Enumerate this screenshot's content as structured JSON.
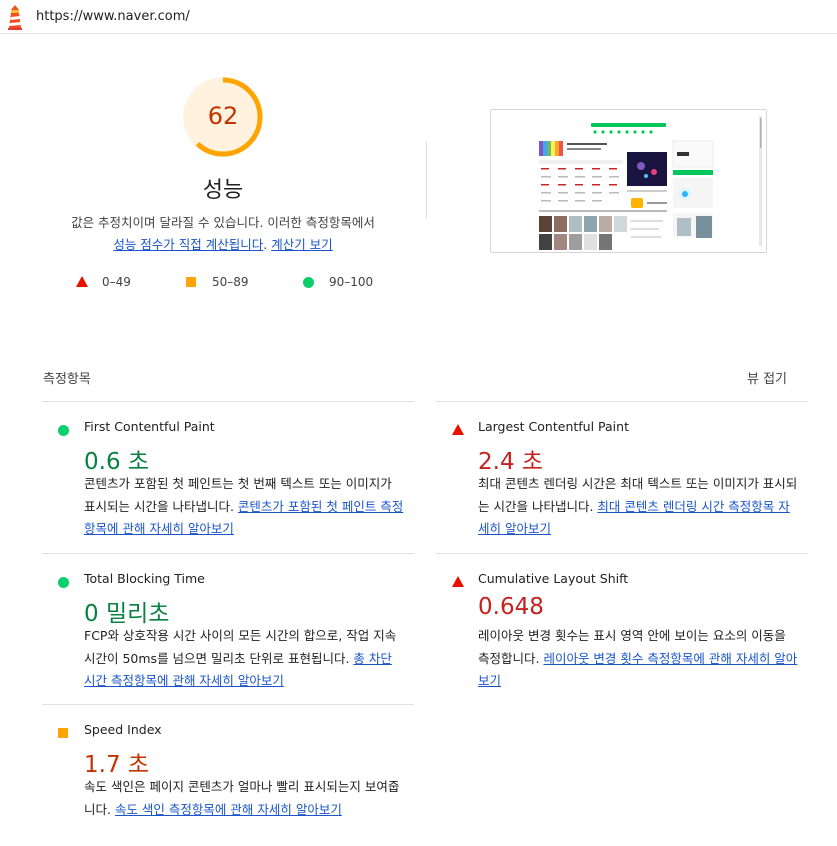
{
  "browser": {
    "url": "https://www.naver.com/"
  },
  "score": {
    "value": 62,
    "fraction": 0.62,
    "color": "#ffa400",
    "text_color": "#c33300",
    "bg_color": "#fff3e0"
  },
  "performance": {
    "title": "성능",
    "desc_text": "값은 추정치이며 달라질 수 있습니다. 이러한 측정항목에서",
    "desc_link1": "성능 점수가 직접 계산됩니다",
    "desc_sep": ". ",
    "desc_link2": "계산기 보기"
  },
  "legend": [
    {
      "label": "0–49",
      "icon": "fail-triangle-icon",
      "color": "#eb0f00"
    },
    {
      "label": "50–89",
      "icon": "average-square-icon",
      "color": "#ffa400"
    },
    {
      "label": "90–100",
      "icon": "pass-circle-icon",
      "color": "#0cce6b"
    }
  ],
  "metrics_section": {
    "title": "측정항목",
    "collapse_label": "뷰 접기"
  },
  "metrics": [
    {
      "name": "First Contentful Paint",
      "value": "0.6 초",
      "status": "pass",
      "desc": "콘텐츠가 포함된 첫 페인트는 첫 번째 텍스트 또는 이미지가 표시되는 시간을 나타냅니다. ",
      "link": "콘텐츠가 포함된 첫 페인트 측정항목에 관해 자세히 알아보기"
    },
    {
      "name": "Largest Contentful Paint",
      "value": "2.4 초",
      "status": "fail",
      "desc": "최대 콘텐츠 렌더링 시간은 최대 텍스트 또는 이미지가 표시되는 시간을 나타냅니다. ",
      "link": "최대 콘텐츠 렌더링 시간 측정항목 자세히 알아보기"
    },
    {
      "name": "Total Blocking Time",
      "value": "0 밀리초",
      "status": "pass",
      "desc": "FCP와 상호작용 시간 사이의 모든 시간의 합으로, 작업 지속 시간이 50ms를 넘으면 밀리초 단위로 표현됩니다. ",
      "link": "총 차단 시간 측정항목에 관해 자세히 알아보기"
    },
    {
      "name": "Cumulative Layout Shift",
      "value": "0.648",
      "status": "fail",
      "desc": "레이아웃 변경 횟수는 표시 영역 안에 보이는 요소의 이동을 측정합니다. ",
      "link": "레이아웃 변경 횟수 측정항목에 관해 자세히 알아보기"
    },
    {
      "name": "Speed Index",
      "value": "1.7 초",
      "status": "average",
      "desc": "속도 색인은 페이지 콘텐츠가 얼마나 빨리 표시되는지 보여줍니다. ",
      "link": "속도 색인 측정항목에 관해 자세히 알아보기"
    }
  ]
}
